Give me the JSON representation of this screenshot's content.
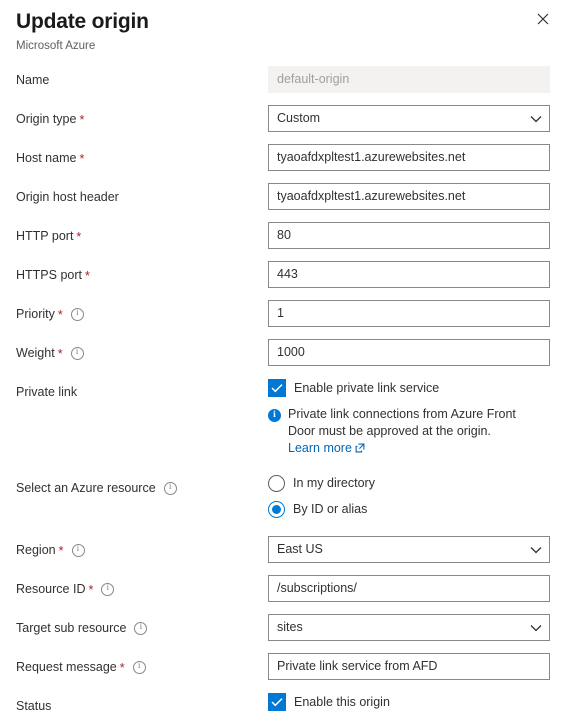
{
  "header": {
    "title": "Update origin",
    "subtitle": "Microsoft Azure",
    "close_icon": "close-icon"
  },
  "colors": {
    "accent": "#0078d4",
    "link": "#0067b8",
    "required_asterisk": "#a4262c",
    "disabled_bg": "#f3f2f1",
    "border": "#8a8886",
    "text": "#323130"
  },
  "fields": {
    "name": {
      "label": "Name",
      "value": "default-origin",
      "required": false,
      "disabled": true,
      "has_info": false
    },
    "origin_type": {
      "label": "Origin type",
      "value": "Custom",
      "required": true,
      "has_info": false,
      "options": [
        "Custom"
      ]
    },
    "host_name": {
      "label": "Host name",
      "value": "tyaoafdxpltest1.azurewebsites.net",
      "required": true,
      "has_info": false
    },
    "origin_host_header": {
      "label": "Origin host header",
      "value": "tyaoafdxpltest1.azurewebsites.net",
      "required": false,
      "has_info": false
    },
    "http_port": {
      "label": "HTTP port",
      "value": "80",
      "required": true,
      "has_info": false
    },
    "https_port": {
      "label": "HTTPS port",
      "value": "443",
      "required": true,
      "has_info": false
    },
    "priority": {
      "label": "Priority",
      "value": "1",
      "required": true,
      "has_info": true
    },
    "weight": {
      "label": "Weight",
      "value": "1000",
      "required": true,
      "has_info": true
    },
    "private_link": {
      "label": "Private link",
      "checkbox_label": "Enable private link service",
      "checked": true,
      "message": "Private link connections from Azure Front Door must be approved at the origin.",
      "link_text": "Learn more",
      "link_icon": "external-link-icon"
    },
    "select_azure_resource": {
      "label": "Select an Azure resource",
      "has_info": true,
      "options": [
        {
          "label": "In my directory",
          "selected": false
        },
        {
          "label": "By ID or alias",
          "selected": true
        }
      ]
    },
    "region": {
      "label": "Region",
      "value": "East US",
      "required": true,
      "has_info": true,
      "options": [
        "East US"
      ]
    },
    "resource_id": {
      "label": "Resource ID",
      "value": "/subscriptions/",
      "required": true,
      "has_info": true
    },
    "target_sub_resource": {
      "label": "Target sub resource",
      "value": "sites",
      "required": false,
      "has_info": true,
      "options": [
        "sites"
      ]
    },
    "request_message": {
      "label": "Request message",
      "value": "Private link service from AFD",
      "required": true,
      "has_info": true
    },
    "status": {
      "label": "Status",
      "checkbox_label": "Enable this origin",
      "checked": true
    }
  }
}
